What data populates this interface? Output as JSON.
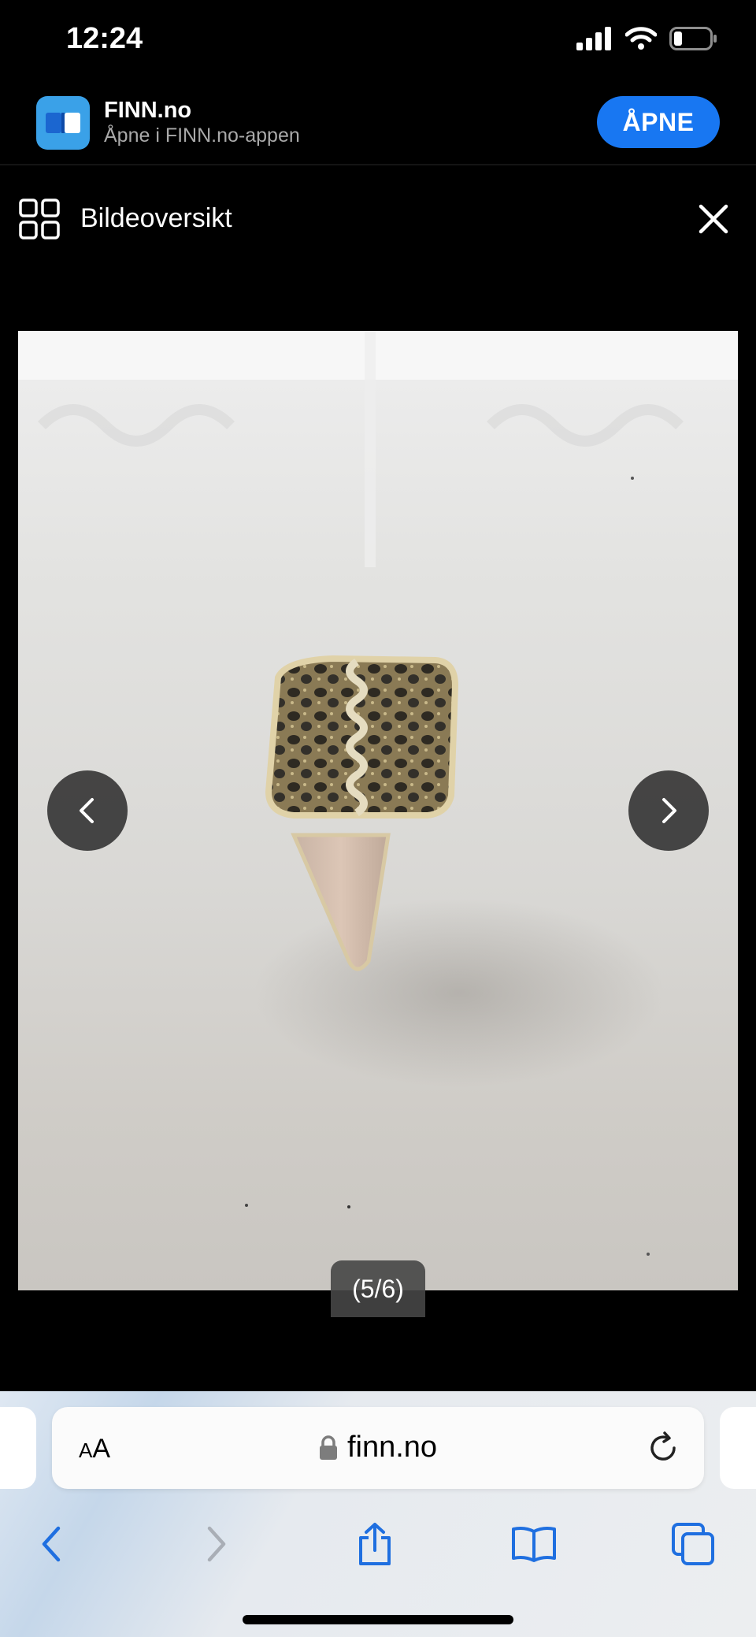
{
  "status_bar": {
    "time": "12:24"
  },
  "app_banner": {
    "name": "FINN.no",
    "subtitle": "Åpne i FINN.no-appen",
    "open_label": "ÅPNE"
  },
  "gallery": {
    "title": "Bildeoversikt",
    "counter": "(5/6)"
  },
  "browser": {
    "text_size_small": "A",
    "text_size_large": "A",
    "url": "finn.no"
  },
  "colors": {
    "accent": "#1877f2",
    "app_icon": "#3aa1e8",
    "browser_blue": "#1f6fe0"
  }
}
